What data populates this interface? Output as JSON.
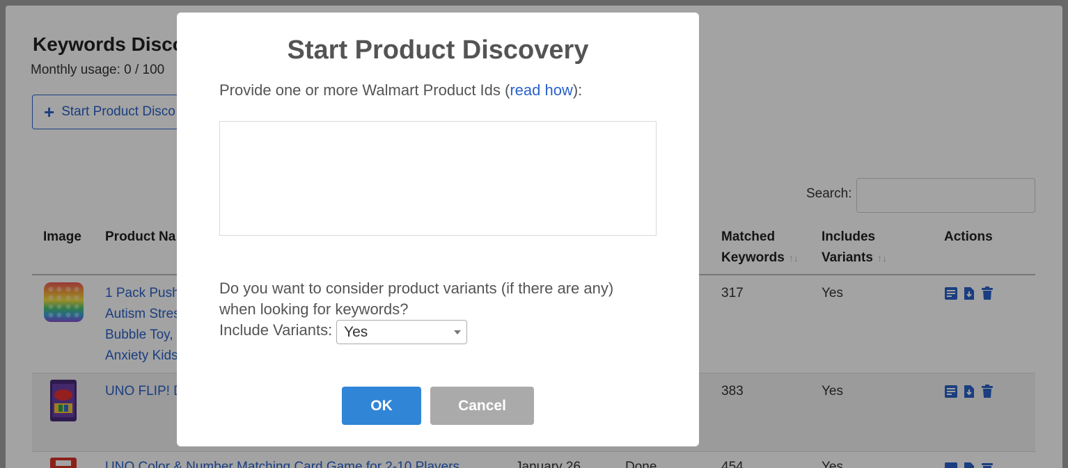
{
  "page": {
    "title": "Keywords Disco",
    "usage": "Monthly usage: 0 / 100",
    "start_button": "Start Product Disco",
    "search_label": "Search:"
  },
  "table": {
    "headers": {
      "image": "Image",
      "product_name": "Product Na",
      "matched_line1": "Matched",
      "matched_line2": "Keywords",
      "includes_line1": "Includes",
      "includes_line2": "Variants",
      "actions": "Actions"
    },
    "rows": [
      {
        "name_lines": [
          "1 Pack Push",
          "Autism Stres",
          "Bubble Toy,",
          "Anxiety Kids"
        ],
        "matched": "317",
        "variants": "Yes"
      },
      {
        "name_lines": [
          "UNO FLIP! D"
        ],
        "matched": "383",
        "variants": "Yes"
      },
      {
        "name_lines": [
          "UNO Color & Number Matching Card Game for 2-10 Players"
        ],
        "date": "January 26",
        "status": "Done",
        "matched": "454",
        "variants": "Yes"
      }
    ]
  },
  "modal": {
    "title": "Start Product Discovery",
    "prompt_before": "Provide one or more Walmart Product Ids (",
    "prompt_link": "read how",
    "prompt_after": "):",
    "textarea_value": "",
    "variants_question_line1": "Do you want to consider product variants (if there are any)",
    "variants_question_line2": "when looking for keywords?",
    "variants_label": "Include Variants:",
    "variants_selected": "Yes",
    "ok_label": "OK",
    "cancel_label": "Cancel"
  },
  "colors": {
    "accent": "#3085d6",
    "link": "#2a62c9",
    "cancel": "#aaaaaa",
    "overlay": "rgba(0,0,0,0.36)"
  }
}
